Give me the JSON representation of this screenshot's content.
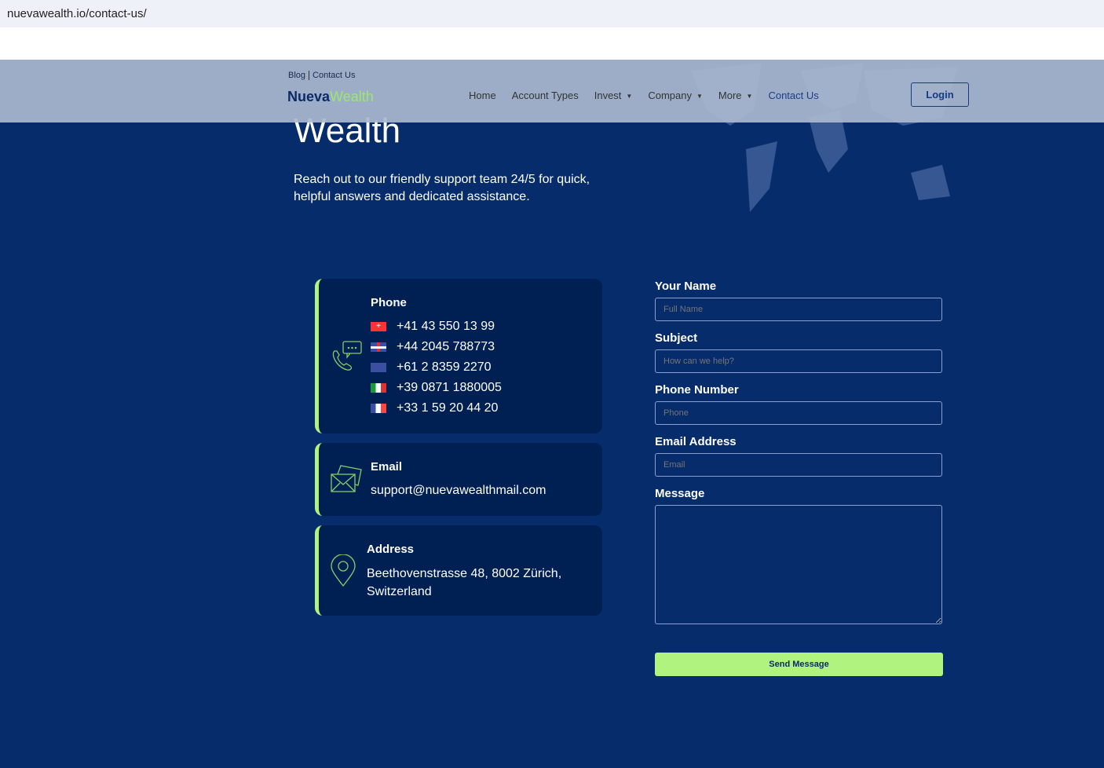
{
  "browser": {
    "url": "nuevawealth.io/contact-us/"
  },
  "header": {
    "top_links": [
      "Blog",
      "Contact Us"
    ],
    "logo_part1": "Nueva",
    "logo_part2": "Wealth",
    "nav": [
      "Home",
      "Account Types",
      "Invest",
      "Company",
      "More",
      "Contact Us"
    ],
    "login": "Login"
  },
  "hero": {
    "title_fragment": "Wealth",
    "lead": "Reach out to our friendly support team 24/5 for quick, helpful answers and dedicated assistance."
  },
  "phone": {
    "title": "Phone",
    "numbers": [
      {
        "country": "Switzerland",
        "number": "+41 43 550 13 99"
      },
      {
        "country": "United Kingdom",
        "number": "+44 2045 788773"
      },
      {
        "country": "Australia",
        "number": "+61 2 8359 2270"
      },
      {
        "country": "Italy",
        "number": "+39 0871 1880005"
      },
      {
        "country": "France",
        "number": "+33 1 59 20 44 20"
      }
    ]
  },
  "email": {
    "title": "Email",
    "value": "support@nuevawealthmail.com"
  },
  "address": {
    "title": "Address",
    "line1": "Beethovenstrasse 48, 8002 Zürich,",
    "line2": "Switzerland"
  },
  "form": {
    "name_label": "Your Name",
    "name_ph": "Full Name",
    "subject_label": "Subject",
    "subject_ph": "How can we help?",
    "phone_label": "Phone Number",
    "phone_ph": "Phone",
    "email_label": "Email Address",
    "email_ph": "Email",
    "message_label": "Message",
    "send": "Send Message"
  },
  "colors": {
    "accent": "#b0f47f",
    "bg": "#072c6c",
    "card": "#001f52"
  }
}
